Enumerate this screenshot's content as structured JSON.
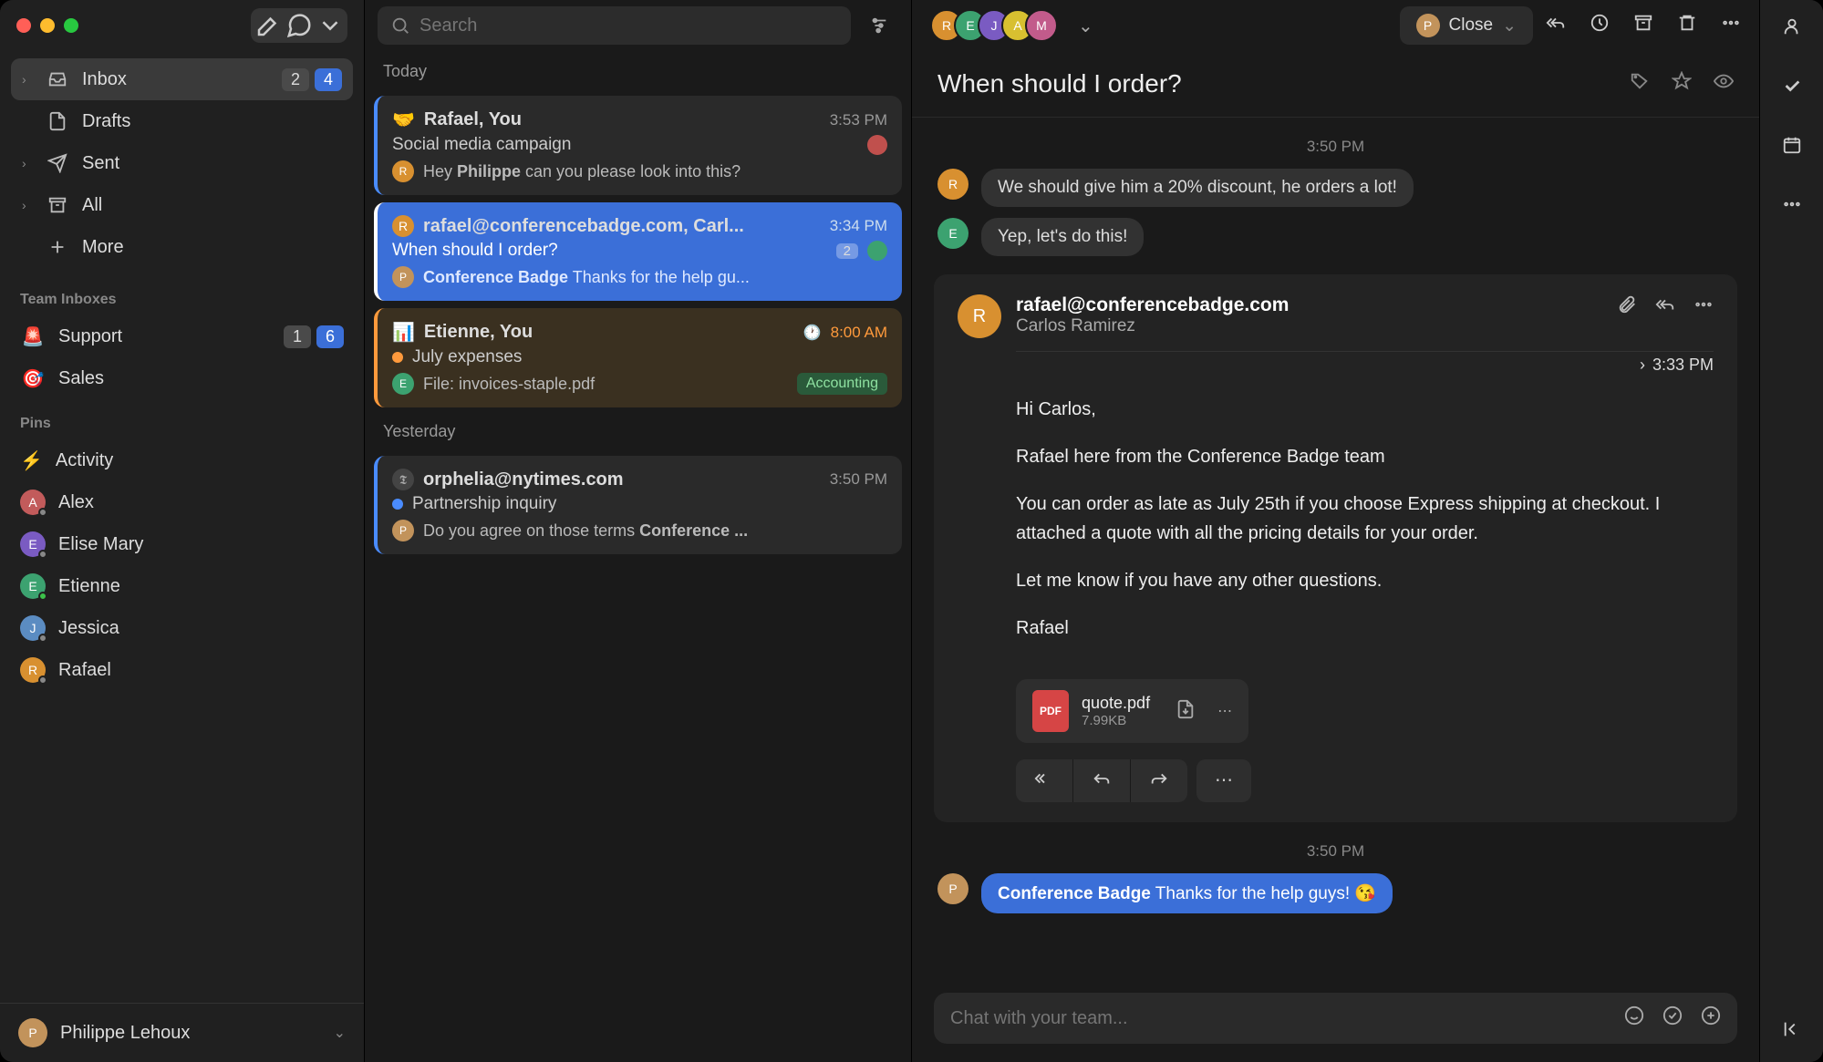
{
  "search": {
    "placeholder": "Search"
  },
  "nav": {
    "inbox": {
      "label": "Inbox",
      "count_a": "2",
      "count_b": "4"
    },
    "drafts": {
      "label": "Drafts"
    },
    "sent": {
      "label": "Sent"
    },
    "all": {
      "label": "All"
    },
    "more": {
      "label": "More"
    }
  },
  "sections": {
    "team": "Team Inboxes",
    "pins": "Pins"
  },
  "team": {
    "support": {
      "emoji": "🚨",
      "label": "Support",
      "a": "1",
      "b": "6"
    },
    "sales": {
      "emoji": "🎯",
      "label": "Sales"
    }
  },
  "pins": {
    "activity": {
      "emoji": "⚡",
      "label": "Activity"
    },
    "alex": {
      "label": "Alex"
    },
    "elise": {
      "label": "Elise Mary"
    },
    "etienne": {
      "label": "Etienne"
    },
    "jessica": {
      "label": "Jessica"
    },
    "rafael": {
      "label": "Rafael"
    }
  },
  "user": {
    "name": "Philippe Lehoux"
  },
  "threadlist": {
    "today": "Today",
    "yesterday": "Yesterday",
    "t1": {
      "emoji": "🤝",
      "sender": "Rafael, You",
      "time": "3:53 PM",
      "subject": "Social media campaign",
      "preview_prefix": "Hey ",
      "preview_bold": "Philippe",
      "preview_rest": " can you please look into this?"
    },
    "t2": {
      "sender": "rafael@conferencebadge.com, Carl...",
      "time": "3:34 PM",
      "subject": "When should I order?",
      "count": "2",
      "preview_bold": "Conference Badge",
      "preview_rest": " Thanks for the help gu..."
    },
    "t3": {
      "emoji": "📊",
      "sender": "Etienne, You",
      "time": "8:00 AM",
      "subject": "July expenses",
      "preview": "File: invoices-staple.pdf",
      "tag": "Accounting"
    },
    "t4": {
      "sender": "orphelia@nytimes.com",
      "time": "3:50 PM",
      "subject": "Partnership inquiry",
      "preview_prefix": "Do you agree on those terms ",
      "preview_bold": "Conference ..."
    }
  },
  "convo": {
    "close": "Close",
    "subject": "When should I order?",
    "ts1": "3:50 PM",
    "msg1": "We should give him a 20% discount, he orders a lot!",
    "msg2": "Yep, let's do this!",
    "email": {
      "from": "rafael@conferencebadge.com",
      "to": "Carlos Ramirez",
      "time": "3:33 PM",
      "p1": "Hi Carlos,",
      "p2": "Rafael here from the Conference Badge team",
      "p3": "You can order as late as July 25th if you choose Express shipping at checkout. I attached a quote with all the pricing details for your order.",
      "p4": "Let me know if you have any other questions.",
      "p5": "Rafael",
      "att_name": "quote.pdf",
      "att_size": "7.99KB"
    },
    "ts2": "3:50 PM",
    "msg3_bold": "Conference Badge",
    "msg3_rest": " Thanks for the help guys! 😘",
    "compose_placeholder": "Chat with your team..."
  }
}
